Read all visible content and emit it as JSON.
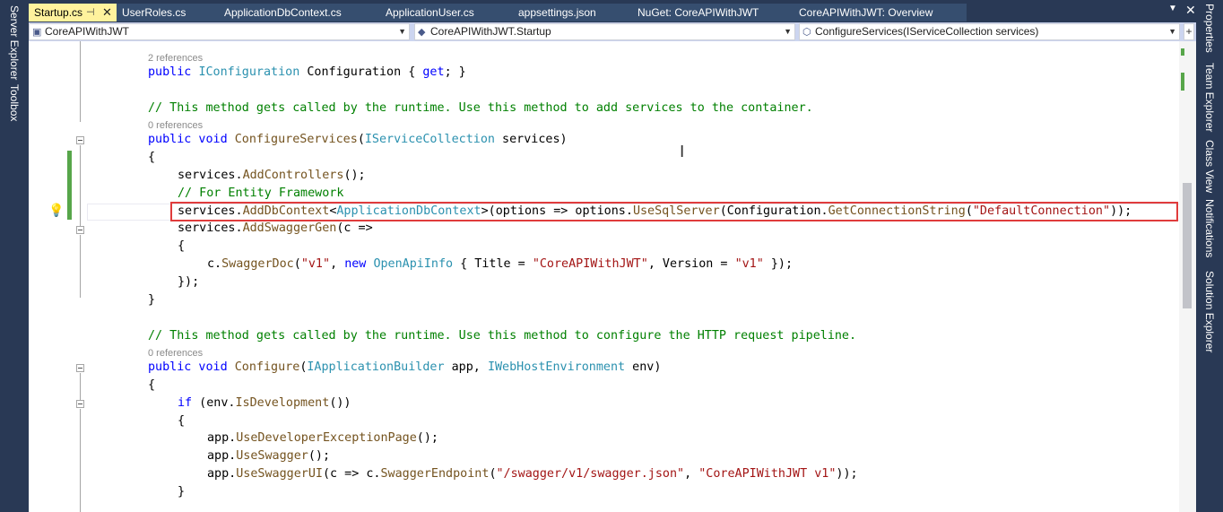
{
  "left_dock": {
    "items": [
      "Server Explorer",
      "Toolbox"
    ]
  },
  "right_dock": {
    "items": [
      "Properties",
      "Team Explorer",
      "Class View",
      "Notifications",
      "Solution Explorer"
    ]
  },
  "tabs": [
    {
      "label": "Startup.cs",
      "active": true
    },
    {
      "label": "UserRoles.cs"
    },
    {
      "label": "ApplicationDbContext.cs"
    },
    {
      "label": "ApplicationUser.cs"
    },
    {
      "label": "appsettings.json"
    },
    {
      "label": "NuGet: CoreAPIWithJWT"
    },
    {
      "label": "CoreAPIWithJWT: Overview"
    }
  ],
  "navbar": {
    "project": "CoreAPIWithJWT",
    "type": "CoreAPIWithJWT.Startup",
    "member": "ConfigureServices(IServiceCollection services)"
  },
  "code": {
    "lens1": "2 references",
    "l1_kw": "public ",
    "l1_ty": "IConfiguration",
    "l1_rest": " Configuration { ",
    "l1_get": "get",
    "l1_end": "; }",
    "c1": "// This method gets called by the runtime. Use this method to add services to the container.",
    "lens2": "0 references",
    "l2_kw": "public void ",
    "l2_m": "ConfigureServices",
    "l2_p": "(",
    "l2_ty": "IServiceCollection",
    "l2_rest": " services)",
    "brace_open": "{",
    "l3_a": "services.",
    "l3_m": "AddControllers",
    "l3_b": "();",
    "c2": "// For Entity Framework",
    "l4_a": "services.",
    "l4_m": "AddDbContext",
    "l4_b": "<",
    "l4_ty": "ApplicationDbContext",
    "l4_c": ">(options => options.",
    "l4_m2": "UseSqlServer",
    "l4_d": "(Configuration.",
    "l4_m3": "GetConnectionString",
    "l4_e": "(",
    "l4_st": "\"DefaultConnection\"",
    "l4_f": "));",
    "l5_a": "services.",
    "l5_m": "AddSwaggerGen",
    "l5_b": "(c =>",
    "l6": "{",
    "l7_a": "c.",
    "l7_m": "SwaggerDoc",
    "l7_b": "(",
    "l7_s1": "\"v1\"",
    "l7_c": ", ",
    "l7_new": "new ",
    "l7_ty": "OpenApiInfo",
    "l7_d": " { Title = ",
    "l7_s2": "\"CoreAPIWithJWT\"",
    "l7_e": ", Version = ",
    "l7_s3": "\"v1\"",
    "l7_f": " });",
    "l8": "});",
    "brace_close": "}",
    "c3": "// This method gets called by the runtime. Use this method to configure the HTTP request pipeline.",
    "lens3": "0 references",
    "l9_kw": "public void ",
    "l9_m": "Configure",
    "l9_p": "(",
    "l9_ty1": "IApplicationBuilder",
    "l9_a": " app, ",
    "l9_ty2": "IWebHostEnvironment",
    "l9_b": " env)",
    "l10_kw": "if",
    "l10_a": " (env.",
    "l10_m": "IsDevelopment",
    "l10_b": "())",
    "l11_a": "app.",
    "l11_m": "UseDeveloperExceptionPage",
    "l11_b": "();",
    "l12_a": "app.",
    "l12_m": "UseSwagger",
    "l12_b": "();",
    "l13_a": "app.",
    "l13_m": "UseSwaggerUI",
    "l13_b": "(c => c.",
    "l13_m2": "SwaggerEndpoint",
    "l13_c": "(",
    "l13_s1": "\"/swagger/v1/swagger.json\"",
    "l13_d": ", ",
    "l13_s2": "\"CoreAPIWithJWT v1\"",
    "l13_e": "));"
  }
}
